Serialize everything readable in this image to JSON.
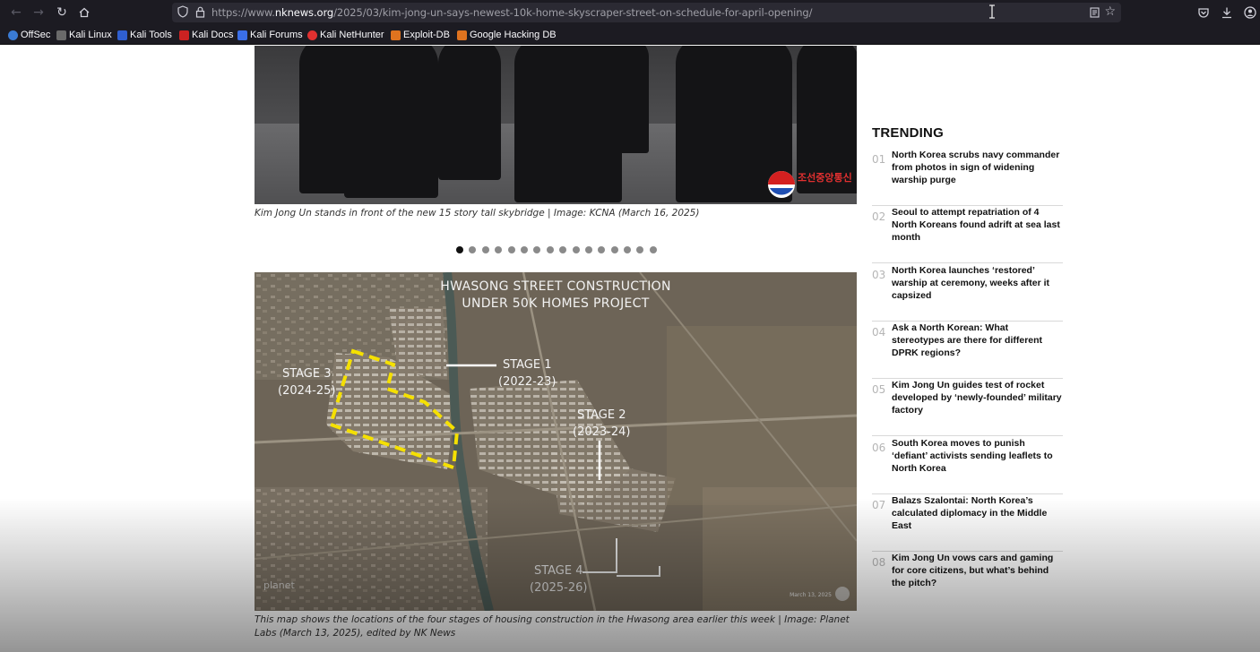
{
  "browser": {
    "url_prefix": "https://www.",
    "url_domain": "nknews.org",
    "url_path": "/2025/03/kim-jong-un-says-newest-10k-home-skyscraper-street-on-schedule-for-april-opening/"
  },
  "bookmarks": [
    {
      "label": "OffSec",
      "color": "#3a7bd5"
    },
    {
      "label": "Kali Linux",
      "color": "#2a2a2a"
    },
    {
      "label": "Kali Tools",
      "color": "#2f5fd0"
    },
    {
      "label": "Kali Docs",
      "color": "#cc2222"
    },
    {
      "label": "Kali Forums",
      "color": "#3a6ee8"
    },
    {
      "label": "Kali NetHunter",
      "color": "#e03030"
    },
    {
      "label": "Exploit-DB",
      "color": "#e0731f"
    },
    {
      "label": "Google Hacking DB",
      "color": "#e0731f"
    }
  ],
  "article": {
    "photo_logo_text": "조선중앙통신",
    "photo_caption": "Kim Jong Un stands in front of the new 15 story tall skybridge | Image: KCNA (March 16, 2025)",
    "slide_count": 16,
    "active_slide": 1,
    "map": {
      "title_line1": "HWASONG STREET CONSTRUCTION",
      "title_line2": "UNDER 50K",
      "title_line2b": " HOMES PROJECT",
      "stages": [
        {
          "name": "STAGE 1",
          "years": "(2022-23)"
        },
        {
          "name": "STAGE 2",
          "years": "(2023-24)"
        },
        {
          "name": "STAGE 3",
          "years": "(2024-25)"
        },
        {
          "name": "STAGE 4",
          "years": "(2025-26)"
        }
      ],
      "watermark": "planet",
      "date_stamp": "March 13, 2025"
    },
    "map_caption": "This map shows the locations of the four stages of housing construction in the Hwasong area earlier this week | Image: Planet Labs (March 13, 2025), edited by NK News"
  },
  "trending": {
    "title": "TRENDING",
    "items": [
      {
        "num": "01",
        "text": "North Korea scrubs navy commander from photos in sign of widening warship purge"
      },
      {
        "num": "02",
        "text": "Seoul to attempt repatriation of 4 North Koreans found adrift at sea last month"
      },
      {
        "num": "03",
        "text": "North Korea launches ‘restored’ warship at ceremony, weeks after it capsized"
      },
      {
        "num": "04",
        "text": "Ask a North Korean: What stereotypes are there for different DPRK regions?"
      },
      {
        "num": "05",
        "text": "Kim Jong Un guides test of rocket developed by ‘newly-founded’ military factory"
      },
      {
        "num": "06",
        "text": "South Korea moves to punish ‘defiant’ activists sending leaflets to North Korea"
      },
      {
        "num": "07",
        "text": "Balazs Szalontai: North Korea’s calculated diplomacy in the Middle East"
      },
      {
        "num": "08",
        "text": "Kim Jong Un vows cars and gaming for core citizens, but what’s behind the pitch?"
      }
    ]
  },
  "colors": {
    "chrome_bg": "#1c1b22",
    "urlbar_bg": "#2b2a33",
    "stage3_outline": "#f5e000"
  }
}
